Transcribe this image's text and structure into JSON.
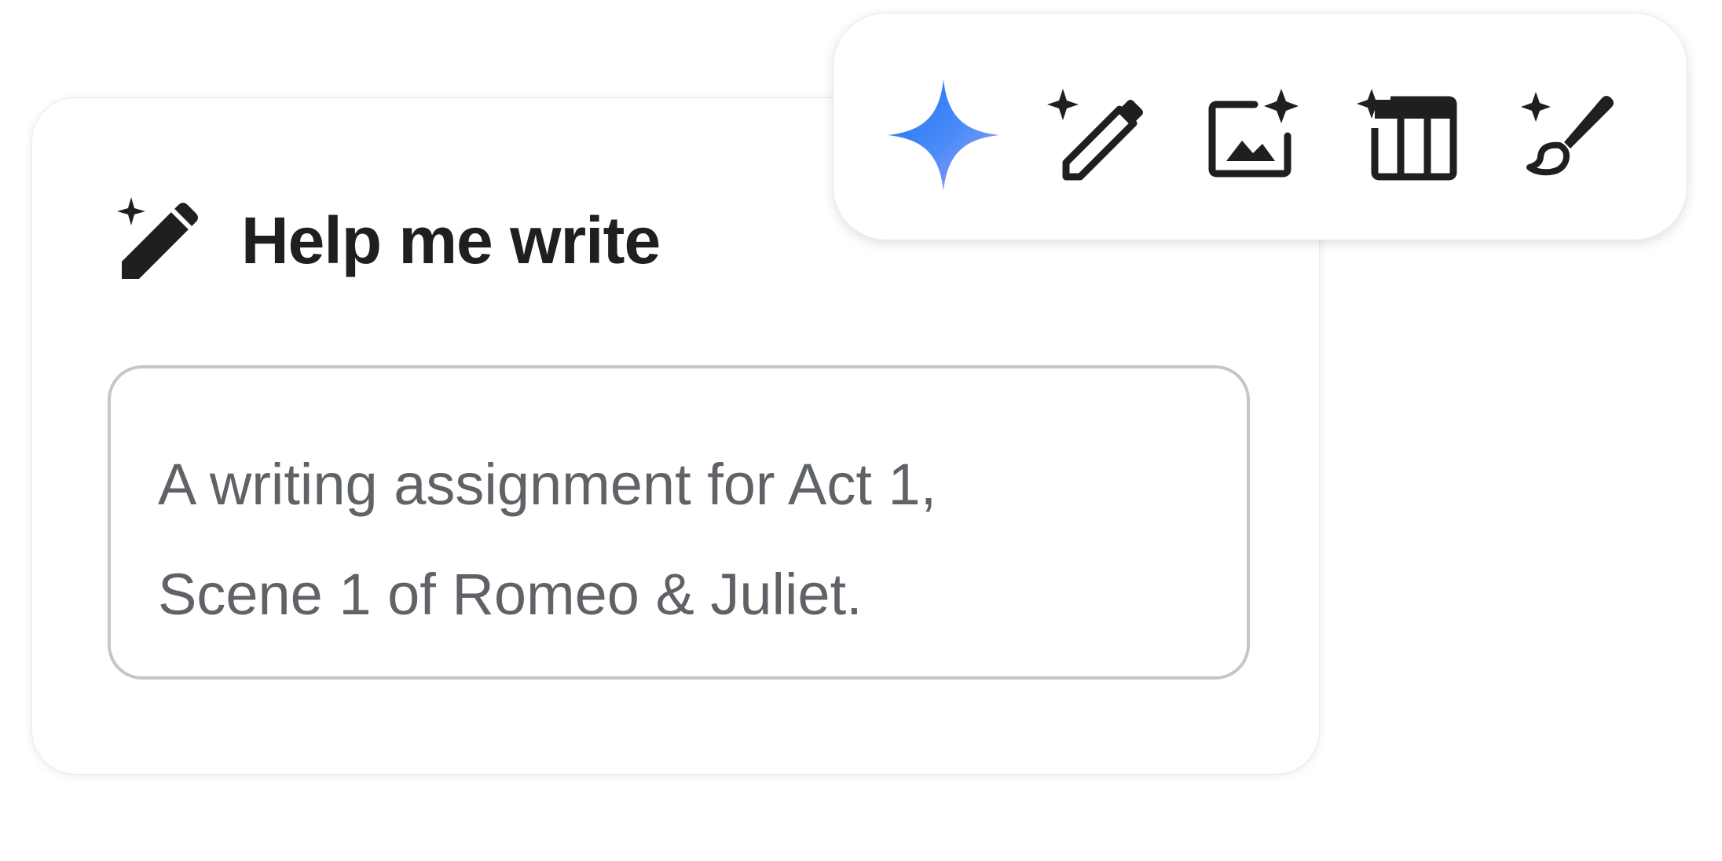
{
  "write_card": {
    "title": "Help me write",
    "title_icon": "magic-wand-icon",
    "prompt": {
      "text": "A writing assignment for Act 1,\nScene 1 of Romeo & Juliet."
    }
  },
  "toolbar": {
    "tools": [
      {
        "icon": "gemini-sparkle-icon"
      },
      {
        "icon": "sparkle-pencil-icon"
      },
      {
        "icon": "sparkle-image-icon"
      },
      {
        "icon": "sparkle-table-icon"
      },
      {
        "icon": "sparkle-brush-icon"
      }
    ]
  },
  "colors": {
    "title_text": "#1f1f1f",
    "prompt_text": "#5f6368",
    "icon_dark": "#1f1f1f",
    "gemini_blue": "#4285f4",
    "gemini_purple": "#a78bfa",
    "border": "#c4c7c5"
  }
}
